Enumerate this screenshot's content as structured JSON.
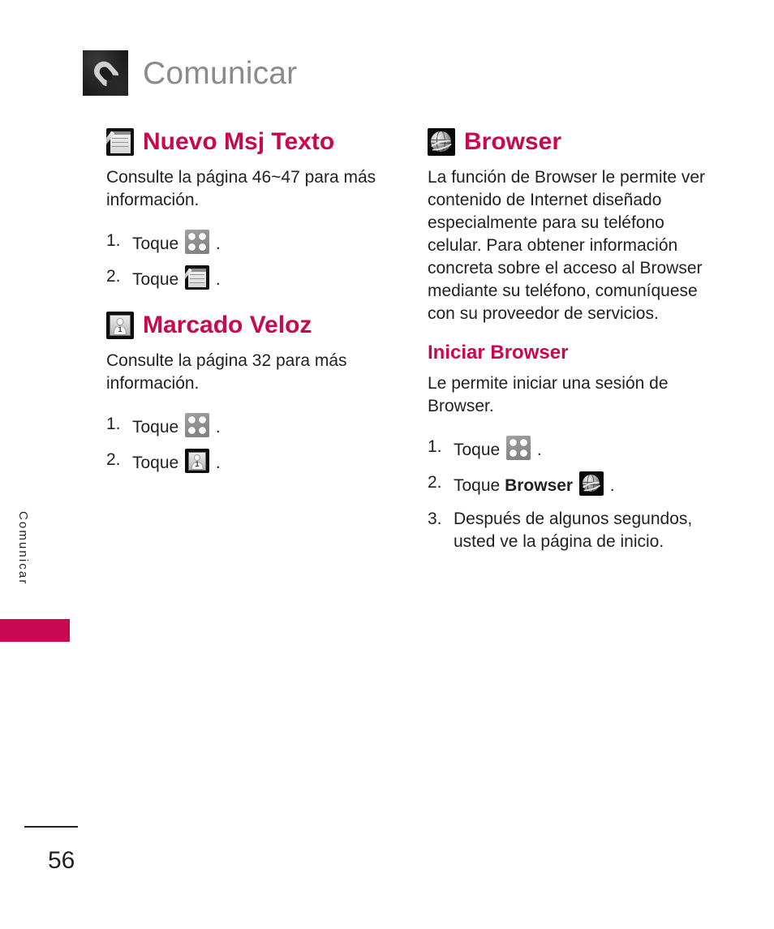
{
  "header": {
    "title": "Comunicar",
    "icon": "phone-handset-icon"
  },
  "side_tab": {
    "label": "Comunicar",
    "marker_color": "#c8094f"
  },
  "theme": {
    "accent": "#c8094f",
    "header_gray": "#8b8b8b",
    "body_color": "#231f20"
  },
  "left_column": {
    "sections": [
      {
        "icon": "notepad-pen-icon",
        "title": "Nuevo Msj Texto",
        "body": "Consulte la página 46~47 para más información.",
        "steps": [
          {
            "num": "1.",
            "text_before": "Toque",
            "icon": "menu-grid-icon",
            "text_after": "."
          },
          {
            "num": "2.",
            "text_before": "Toque",
            "icon": "notepad-pen-icon",
            "text_after": "."
          }
        ]
      },
      {
        "icon": "speed-dial-contact-icon",
        "title": "Marcado Veloz",
        "body": "Consulte la página 32 para más información.",
        "steps": [
          {
            "num": "1.",
            "text_before": "Toque",
            "icon": "menu-grid-icon",
            "text_after": "."
          },
          {
            "num": "2.",
            "text_before": "Toque",
            "icon": "speed-dial-contact-icon",
            "text_after": "."
          }
        ]
      }
    ]
  },
  "right_column": {
    "section": {
      "icon": "globe-browser-icon",
      "title": "Browser",
      "body": "La función de Browser le permite ver contenido de Internet diseñado especialmente para su teléfono celular. Para obtener información concreta sobre el acceso al Browser mediante su teléfono, comuníquese con su proveedor de servicios."
    },
    "subsection": {
      "title": "Iniciar Browser",
      "body": "Le permite iniciar una sesión de Browser.",
      "steps": [
        {
          "num": "1.",
          "text_before": "Toque",
          "bold": "",
          "icon": "menu-grid-icon",
          "text_after": "."
        },
        {
          "num": "2.",
          "text_before": "Toque",
          "bold": "Browser",
          "icon": "globe-browser-icon",
          "text_after": "."
        },
        {
          "num": "3.",
          "text_before": "Después de algunos segundos, usted ve la página de inicio.",
          "bold": "",
          "icon": "",
          "text_after": ""
        }
      ]
    }
  },
  "footer": {
    "page_number": "56"
  }
}
